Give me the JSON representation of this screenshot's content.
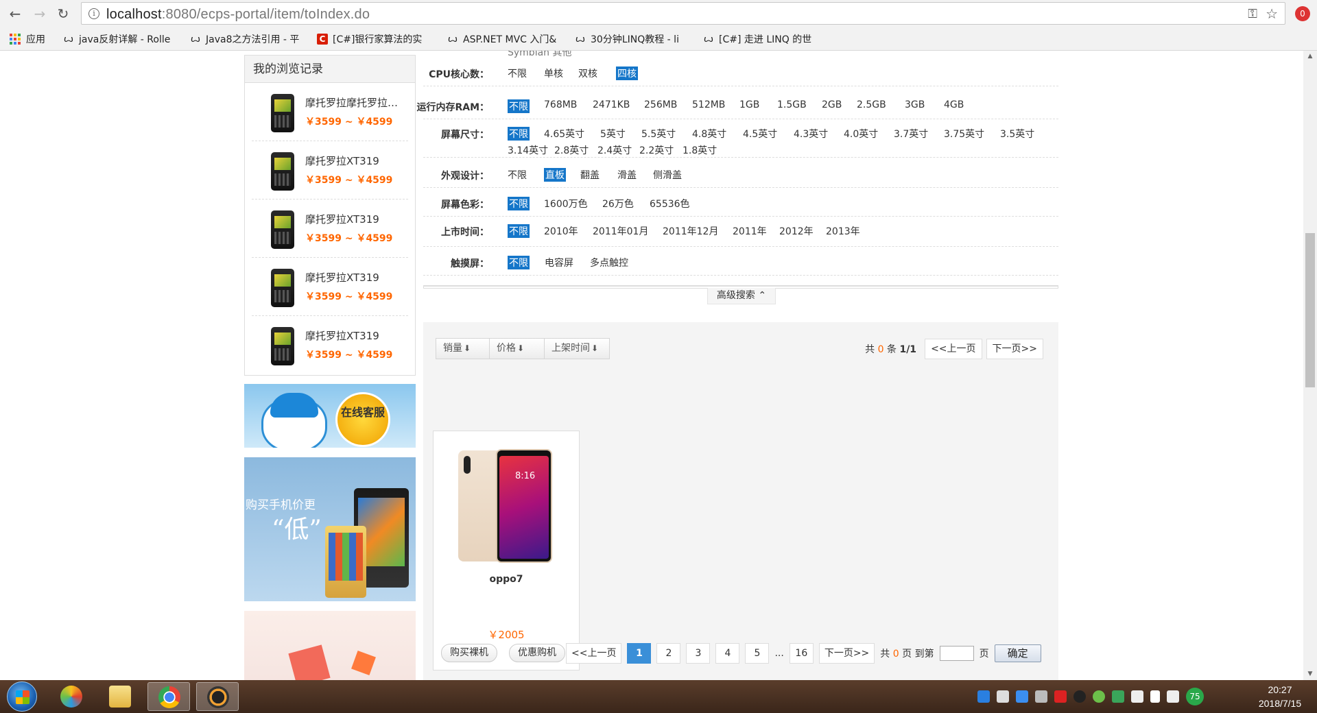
{
  "browser": {
    "url_host": "localhost",
    "url_rest": ":8080/ecps-portal/item/toIndex.do",
    "ext_badge": "0",
    "bookmarks": [
      {
        "label": "应用"
      },
      {
        "label": "java反射详解 - Rolle"
      },
      {
        "label": "Java8之方法引用 - 平"
      },
      {
        "label": "[C#]银行家算法的实"
      },
      {
        "label": "ASP.NET MVC 入门&"
      },
      {
        "label": "30分钟LINQ教程 - li"
      },
      {
        "label": "[C#] 走进 LINQ 的世"
      }
    ]
  },
  "sidebar": {
    "history_title": "我的浏览记录",
    "history": [
      {
        "name": "摩托罗拉摩托罗拉摩托罗拉",
        "price": "￥3599 ~ ￥4599"
      },
      {
        "name": "摩托罗拉XT319",
        "price": "￥3599 ~ ￥4599"
      },
      {
        "name": "摩托罗拉XT319",
        "price": "￥3599 ~ ￥4599"
      },
      {
        "name": "摩托罗拉XT319",
        "price": "￥3599 ~ ￥4599"
      },
      {
        "name": "摩托罗拉XT319",
        "price": "￥3599 ~ ￥4599"
      }
    ],
    "ad_service_text": "在线客服",
    "ad_phone_line1": "购买手机价更",
    "ad_phone_line2": "“低”"
  },
  "filters": {
    "partial_top": "Symbian    其他",
    "rows": [
      {
        "label": "CPU核心数：",
        "options": [
          "不限",
          "单核",
          "双核",
          "四核"
        ],
        "selected": 3
      },
      {
        "label": "运行内存RAM：",
        "options": [
          "不限",
          "768MB",
          "2471KB",
          "256MB",
          "512MB",
          "1GB",
          "1.5GB",
          "2GB",
          "2.5GB",
          "3GB",
          "4GB"
        ],
        "selected": 0
      },
      {
        "label": "屏幕尺寸：",
        "options": [
          "不限",
          "4.65英寸",
          "5英寸",
          "5.5英寸",
          "4.8英寸",
          "4.5英寸",
          "4.3英寸",
          "4.0英寸",
          "3.7英寸",
          "3.75英寸",
          "3.5英寸",
          "3.14英寸",
          "2.8英寸",
          "2.4英寸",
          "2.2英寸",
          "1.8英寸"
        ],
        "selected": 0
      },
      {
        "label": "外观设计：",
        "options": [
          "不限",
          "直板",
          "翻盖",
          "滑盖",
          "侧滑盖"
        ],
        "selected": 1
      },
      {
        "label": "屏幕色彩：",
        "options": [
          "不限",
          "1600万色",
          "26万色",
          "65536色"
        ],
        "selected": 0
      },
      {
        "label": "上市时间：",
        "options": [
          "不限",
          "2010年",
          "2011年01月",
          "2011年12月",
          "2011年",
          "2012年",
          "2013年"
        ],
        "selected": 0
      },
      {
        "label": "触摸屏：",
        "options": [
          "不限",
          "电容屏",
          "多点触控"
        ],
        "selected": 0
      }
    ],
    "advanced_label": "高级搜索",
    "advanced_icon": "⌃"
  },
  "list": {
    "sort": [
      {
        "label": "销量",
        "arrow": "⬇"
      },
      {
        "label": "价格",
        "arrow": "⬇"
      },
      {
        "label": "上架时间",
        "arrow": "⬇"
      }
    ],
    "top_pager": {
      "pre": "共",
      "count": "0",
      "mid": "条",
      "pages": "1/1",
      "prev": "<<上一页",
      "next": "下一页>>"
    },
    "product": {
      "name": "oppo7",
      "price": "￥2005",
      "buy_label": "购买裸机",
      "discount_label": "优惠购机"
    },
    "bottom_pager": {
      "prev": "<<上一页",
      "pages": [
        "1",
        "2",
        "3",
        "4",
        "5"
      ],
      "current": "1",
      "ellipsis": "...",
      "last": "16",
      "next": "下一页>>",
      "total_pre": "共",
      "total_count": "0",
      "total_post": "页 到第",
      "page_suffix": "页",
      "confirm": "确定"
    }
  },
  "taskbar": {
    "time": "20:27",
    "date": "2018/7/15",
    "tray_badge": "75"
  }
}
